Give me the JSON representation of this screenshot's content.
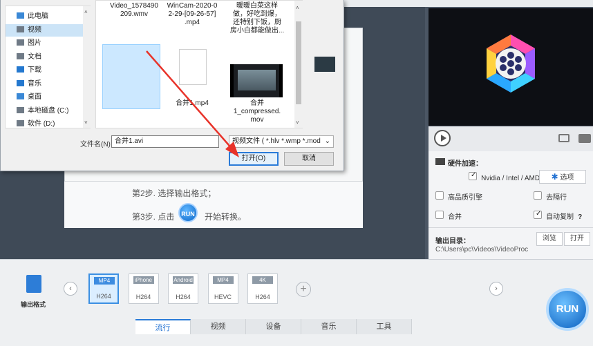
{
  "dialog": {
    "nav_items": [
      {
        "label": "此电脑",
        "icon": "computer-icon"
      },
      {
        "label": "视频",
        "icon": "video-folder-icon"
      },
      {
        "label": "图片",
        "icon": "pictures-folder-icon"
      },
      {
        "label": "文档",
        "icon": "documents-folder-icon"
      },
      {
        "label": "下载",
        "icon": "download-icon"
      },
      {
        "label": "音乐",
        "icon": "music-icon"
      },
      {
        "label": "桌面",
        "icon": "desktop-icon"
      },
      {
        "label": "本地磁盘 (C:)",
        "icon": "drive-icon"
      },
      {
        "label": "软件 (D:)",
        "icon": "drive-icon"
      }
    ],
    "files_top": [
      {
        "name": "Video_1578490\n209.wmv"
      },
      {
        "name": "WinCam-2020-0\n2-29-[09-26-57]\n.mp4"
      },
      {
        "name": "暖暖白菜这样\n做，好吃到爆，\n还特别下饭，厨\n房小白都能做出..."
      }
    ],
    "files": [
      {
        "name": "合并1.avi"
      },
      {
        "name": "合并1.mp4"
      },
      {
        "name": "合并\n1_compressed.\nmov"
      }
    ],
    "filename_label": "文件名(N):",
    "filename_value": "合并1.avi",
    "filetype_value": "视频文件 ( *.hlv *.wmp *.mod",
    "open_label": "打开(O)",
    "cancel_label": "取消"
  },
  "steps": {
    "step2": "第2步. 选择输出格式；",
    "step3_prefix": "第3步. 点击",
    "step3_suffix": "开始转换。",
    "run_small": "RUN"
  },
  "hw": {
    "title": "硬件加速：",
    "gpu_label": "Nvidia / Intel / AMD",
    "gpu_checked": true,
    "options_label": "选项",
    "high_quality": "高品质引擎",
    "deinterlace": "去隔行",
    "merge": "合并",
    "auto_copy": "自动复制",
    "auto_copy_checked": true,
    "help": "?",
    "output_title": "输出目录：",
    "output_path": "C:\\Users\\pc\\Videos\\VideoProc",
    "browse": "浏览",
    "open": "打开"
  },
  "bottom": {
    "output_format_label": "输出格式",
    "formats": [
      {
        "top": "MP4",
        "bottom": "H264",
        "color": "#3d8ce0",
        "selected": true
      },
      {
        "top": "iPhone",
        "bottom": "H264",
        "color": "#8e9aa6",
        "selected": false
      },
      {
        "top": "Android",
        "bottom": "H264",
        "color": "#8e9aa6",
        "selected": false
      },
      {
        "top": "MP4",
        "bottom": "HEVC",
        "color": "#8e9aa6",
        "selected": false
      },
      {
        "top": "4K",
        "bottom": "H264",
        "color": "#8e9aa6",
        "selected": false
      }
    ],
    "tabs": [
      "流行",
      "视频",
      "设备",
      "音乐",
      "工具"
    ],
    "active_tab": 0,
    "run_big": "RUN"
  },
  "colors": {
    "accent": "#2a7bd8",
    "arrow": "#e8332a"
  }
}
